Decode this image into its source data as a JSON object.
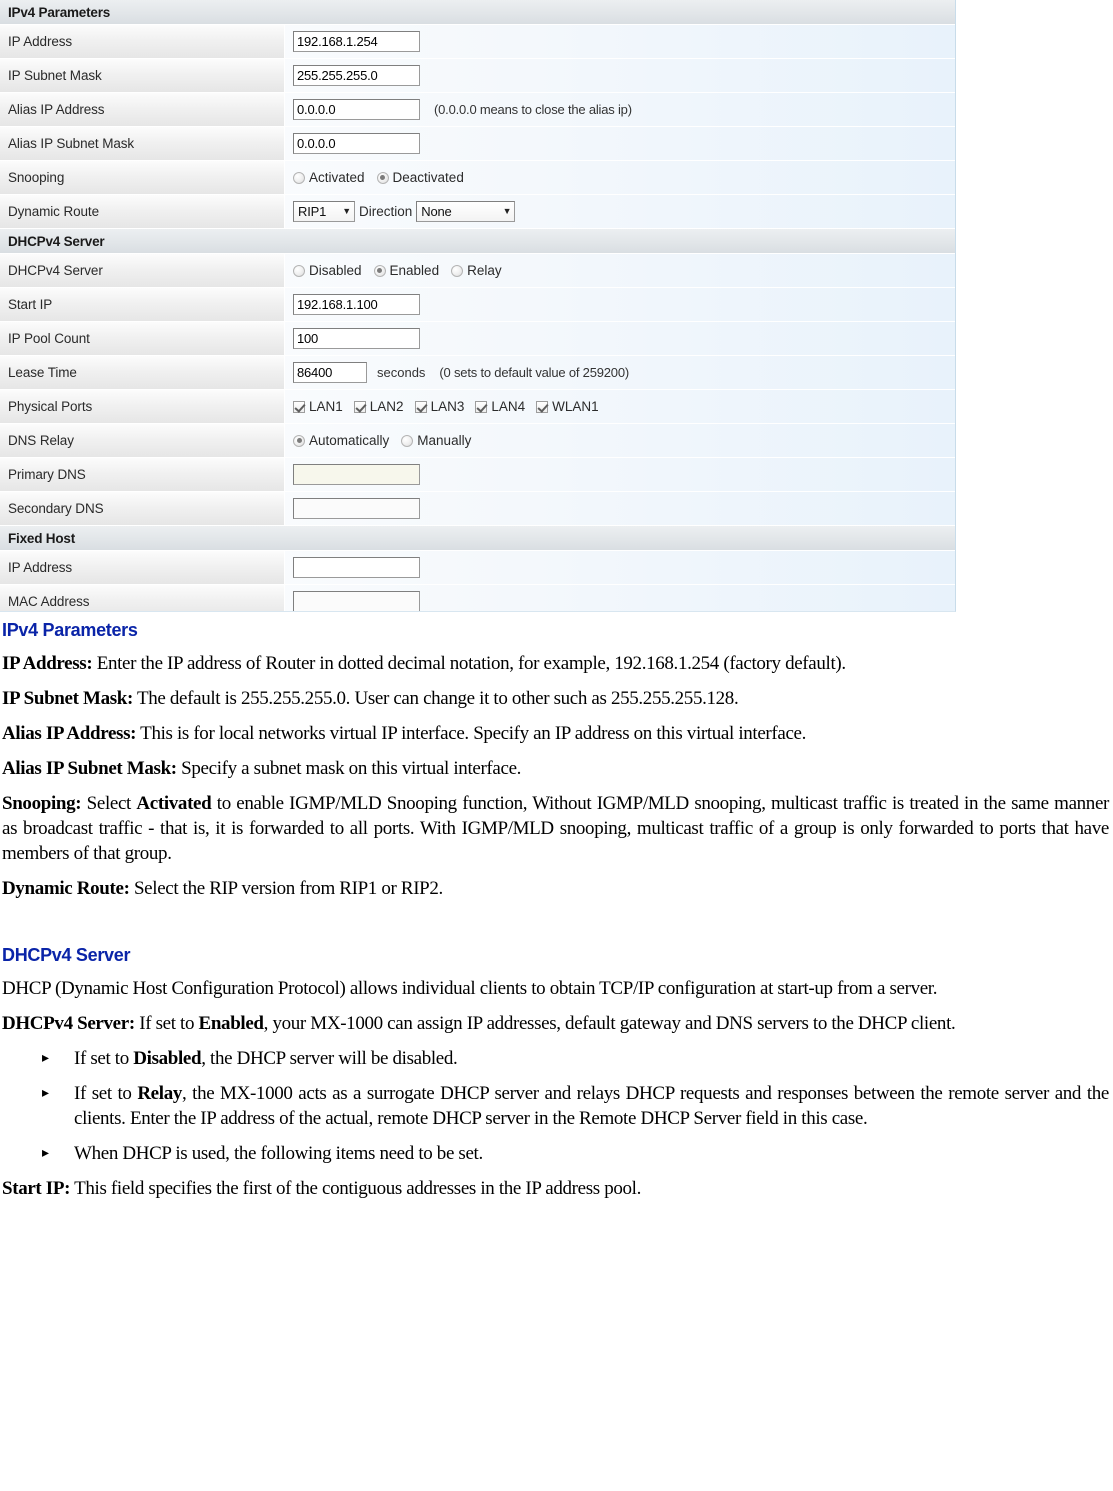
{
  "screenshot": {
    "sections": [
      {
        "type": "section",
        "title": "IPv4 Parameters"
      },
      {
        "type": "row",
        "label": "IP Address",
        "control": "text",
        "value": "192.168.1.254"
      },
      {
        "type": "row",
        "label": "IP Subnet Mask",
        "control": "text",
        "value": "255.255.255.0"
      },
      {
        "type": "row",
        "label": "Alias IP Address",
        "control": "text",
        "value": "0.0.0.0",
        "hint": "(0.0.0.0 means to close the alias ip)"
      },
      {
        "type": "row",
        "label": "Alias IP Subnet Mask",
        "control": "text",
        "value": "0.0.0.0"
      },
      {
        "type": "row",
        "label": "Snooping",
        "control": "radio",
        "options": [
          {
            "label": "Activated",
            "selected": false
          },
          {
            "label": "Deactivated",
            "selected": true
          }
        ]
      },
      {
        "type": "row",
        "label": "Dynamic Route",
        "control": "dualselect",
        "rip_value": "RIP1",
        "direction_label": "Direction",
        "direction_value": "None"
      },
      {
        "type": "section",
        "title": "DHCPv4 Server"
      },
      {
        "type": "row",
        "label": "DHCPv4 Server",
        "control": "radio",
        "options": [
          {
            "label": "Disabled",
            "selected": false
          },
          {
            "label": "Enabled",
            "selected": true
          },
          {
            "label": "Relay",
            "selected": false
          }
        ]
      },
      {
        "type": "row",
        "label": "Start IP",
        "control": "text",
        "value": "192.168.1.100"
      },
      {
        "type": "row",
        "label": "IP Pool Count",
        "control": "text",
        "value": "100"
      },
      {
        "type": "row",
        "label": "Lease Time",
        "control": "text-unit",
        "value": "86400",
        "unit": "seconds",
        "hint": "(0 sets to default value of 259200)"
      },
      {
        "type": "row",
        "label": "Physical Ports",
        "control": "checkbox",
        "options": [
          {
            "label": "LAN1",
            "checked": true
          },
          {
            "label": "LAN2",
            "checked": true
          },
          {
            "label": "LAN3",
            "checked": true
          },
          {
            "label": "LAN4",
            "checked": true
          },
          {
            "label": "WLAN1",
            "checked": true
          }
        ]
      },
      {
        "type": "row",
        "label": "DNS Relay",
        "control": "radio",
        "options": [
          {
            "label": "Automatically",
            "selected": true
          },
          {
            "label": "Manually",
            "selected": false
          }
        ]
      },
      {
        "type": "row",
        "label": "Primary DNS",
        "control": "text-dim",
        "value": ""
      },
      {
        "type": "row",
        "label": "Secondary DNS",
        "control": "text-dim",
        "value": ""
      },
      {
        "type": "section",
        "title": "Fixed Host"
      },
      {
        "type": "row",
        "label": "IP Address",
        "control": "text-empty",
        "value": ""
      },
      {
        "type": "row",
        "label": "MAC Address",
        "control": "text-empty",
        "value": ""
      }
    ]
  },
  "doc": {
    "heading_ipv4": "IPv4 Parameters",
    "p_ip_address_bold": "IP Address:",
    "p_ip_address_text": " Enter the IP address of Router in dotted decimal notation, for example, 192.168.1.254 (factory default).",
    "p_subnet_bold": "IP Subnet Mask:",
    "p_subnet_text": " The default is 255.255.255.0. User can change it to other such as 255.255.255.128.",
    "p_alias_ip_bold": "Alias IP Address:",
    "p_alias_ip_text": " This is for local networks virtual IP interface. Specify an IP address on this virtual interface.",
    "p_alias_mask_bold": "Alias IP Subnet Mask:",
    "p_alias_mask_text": " Specify a subnet mask on this virtual interface.",
    "p_snooping_bold": "Snooping:",
    "p_snooping_t1": " Select ",
    "p_snooping_b2": "Activated",
    "p_snooping_t2": " to enable IGMP/MLD Snooping function, Without IGMP/MLD snooping, multicast traffic is treated in the same manner as broadcast traffic - that is, it is forwarded to all ports. With IGMP/MLD snooping, multicast traffic of a group is only forwarded to ports that have members of that group.",
    "p_dynamic_bold": "Dynamic Route:",
    "p_dynamic_text": " Select the RIP version from RIP1 or RIP2.",
    "heading_dhcp": "DHCPv4 Server",
    "p_dhcp_intro": "DHCP (Dynamic Host Configuration Protocol) allows individual clients to obtain TCP/IP configuration at start-up from a server.",
    "p_dhcpserver_bold": "DHCPv4 Server:",
    "p_dhcpserver_t1": " If set to ",
    "p_dhcpserver_b2": "Enabled",
    "p_dhcpserver_t2": ", your MX-1000 can assign IP addresses, default gateway and DNS servers to the DHCP client.",
    "bullet_arrow": "▸",
    "bullet1_t1": "If set to ",
    "bullet1_b": "Disabled",
    "bullet1_t2": ", the DHCP server will be disabled.",
    "bullet2_t1": "If set to ",
    "bullet2_b": "Relay",
    "bullet2_t2": ", the MX-1000 acts as a surrogate DHCP server and relays DHCP requests and responses between the remote server and the clients. Enter the IP address of the actual, remote DHCP server in the Remote DHCP Server field in this case.",
    "bullet3_text": "When DHCP is used, the following items need to be set.",
    "p_startip_bold": "Start IP:",
    "p_startip_text": " This field specifies the first of the contiguous addresses in the IP address pool."
  }
}
